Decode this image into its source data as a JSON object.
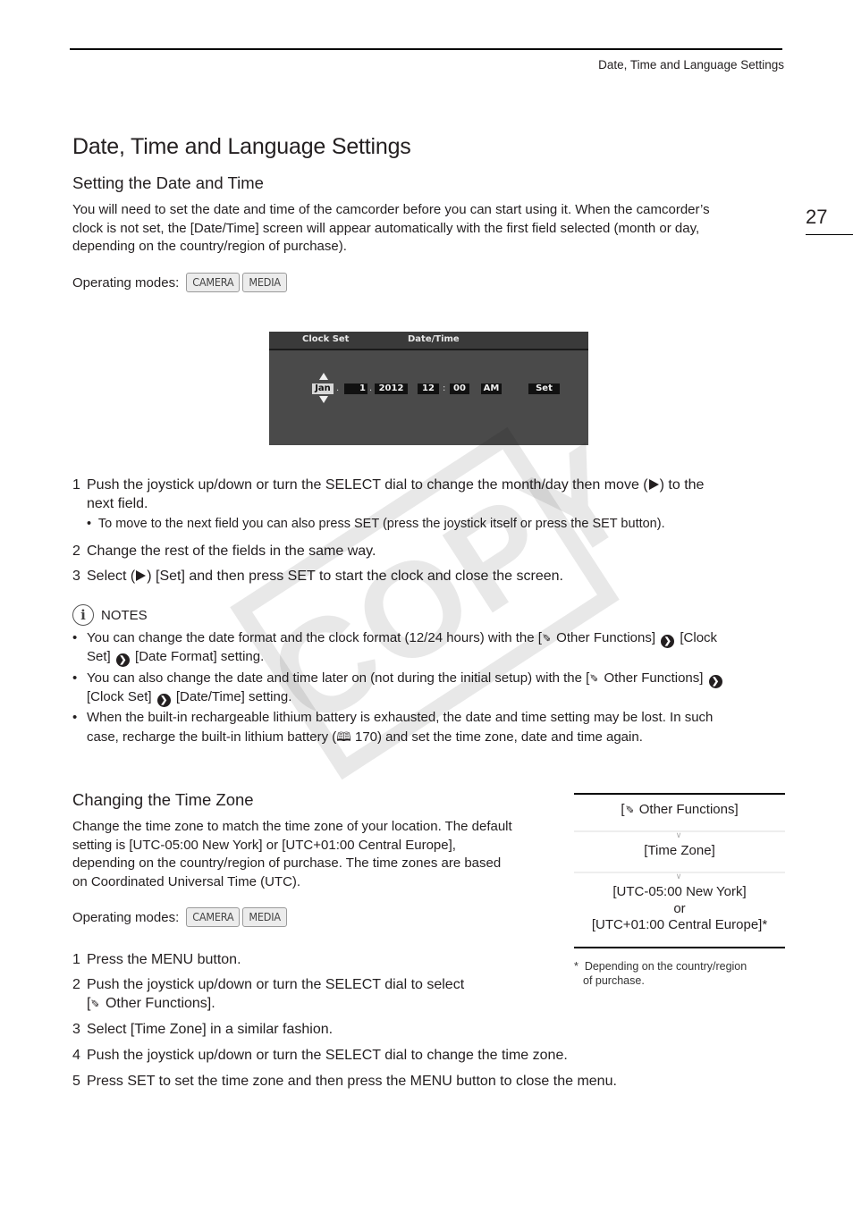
{
  "header": {
    "running_title": "Date, Time and Language Settings",
    "page_number": "27"
  },
  "page_title": "Date, Time and Language Settings",
  "section1": {
    "title": "Setting the Date and Time",
    "intro_lines": [
      "You will need to set the date and time of the camcorder before you can start using it. When the camcorder’s",
      "clock is not set, the [Date/Time] screen will appear automatically with the first field selected (month or day,",
      "depending on the country/region of purchase)."
    ],
    "operating_modes_label": "Operating modes:",
    "modes": [
      "CAMERA",
      "MEDIA"
    ],
    "screen": {
      "menu_label": "Clock Set",
      "screen_label": "Date/Time",
      "month": "Jan",
      "sep1": ".",
      "day": "1",
      "sep2": ".",
      "year": "2012",
      "hour": "12",
      "colon": ":",
      "minute": "00",
      "ampm": "AM",
      "set": "Set",
      "colors": {
        "bg": "#4a4a4a",
        "field": "#111111",
        "selected": "#d8d8d8"
      }
    },
    "steps": [
      {
        "num": "1",
        "line1a": "Push the joystick up/down or turn the SELECT dial to change the month/day then move (",
        "line1b": ") to the",
        "line2": "next field."
      },
      {
        "num": "2",
        "text": "Change the rest of the fields in the same way."
      },
      {
        "num": "3",
        "textA": "Select (",
        "textB": ") [Set] and then press SET to start the clock and close the screen."
      }
    ],
    "step1_sub": "To move to the next field you can also press SET (press the joystick itself or press the SET button).",
    "notes": {
      "label": "NOTES",
      "items": [
        {
          "a": "You can change the date format and the clock format (12/24 hours) with the [",
          "b": " Other Functions] ",
          "c": " [Clock",
          "d": "Set] ",
          "e": " [Date Format] setting."
        },
        {
          "a": "You can also change the date and time later on (not during the initial setup) with the [",
          "b": " Other Functions] ",
          "d": "[Clock Set] ",
          "e": " [Date/Time] setting."
        },
        {
          "a": "When the built-in rechargeable lithium battery is exhausted, the date and time setting may be lost. In such",
          "d": "case, recharge the built-in lithium battery (",
          "page_ref": " 170",
          "e": ") and set the time zone, date and time again."
        }
      ]
    }
  },
  "section2": {
    "title": "Changing the Time Zone",
    "intro_lines": [
      "Change the time zone to match the time zone of your location. The default",
      "setting is [UTC-05:00 New York] or [UTC+01:00 Central Europe],",
      "depending on the country/region of purchase. The time zones are based",
      "on Coordinated Universal Time (UTC)."
    ],
    "operating_modes_label": "Operating modes:",
    "modes": [
      "CAMERA",
      "MEDIA"
    ],
    "steps": [
      {
        "num": "1",
        "text": "Press the MENU button."
      },
      {
        "num": "2",
        "line1": "Push the joystick up/down or turn the SELECT dial to select",
        "line2": " Other Functions]."
      },
      {
        "num": "3",
        "text": "Select [Time Zone] in a similar fashion."
      },
      {
        "num": "4",
        "text": "Push the joystick up/down or turn the SELECT dial to change the time zone."
      },
      {
        "num": "5",
        "text": "Press SET to set the time zone and then press the MENU button to close the menu."
      }
    ],
    "menu_path": {
      "item1": " Other Functions]",
      "item2": "[Time Zone]",
      "item3_line1": "[UTC-05:00 New York]",
      "item3_line2": "or",
      "item3_line3": "[UTC+01:00 Central Europe]*"
    },
    "footnote_line1": "Depending on the country/region",
    "footnote_line2": "of purchase.",
    "footnote_mark": "*"
  },
  "icons": {
    "wrench": "✐",
    "nav_arrow": "❯",
    "book": "🕮",
    "bullet": "•",
    "bracket_open": "["
  },
  "watermark": "COPY"
}
